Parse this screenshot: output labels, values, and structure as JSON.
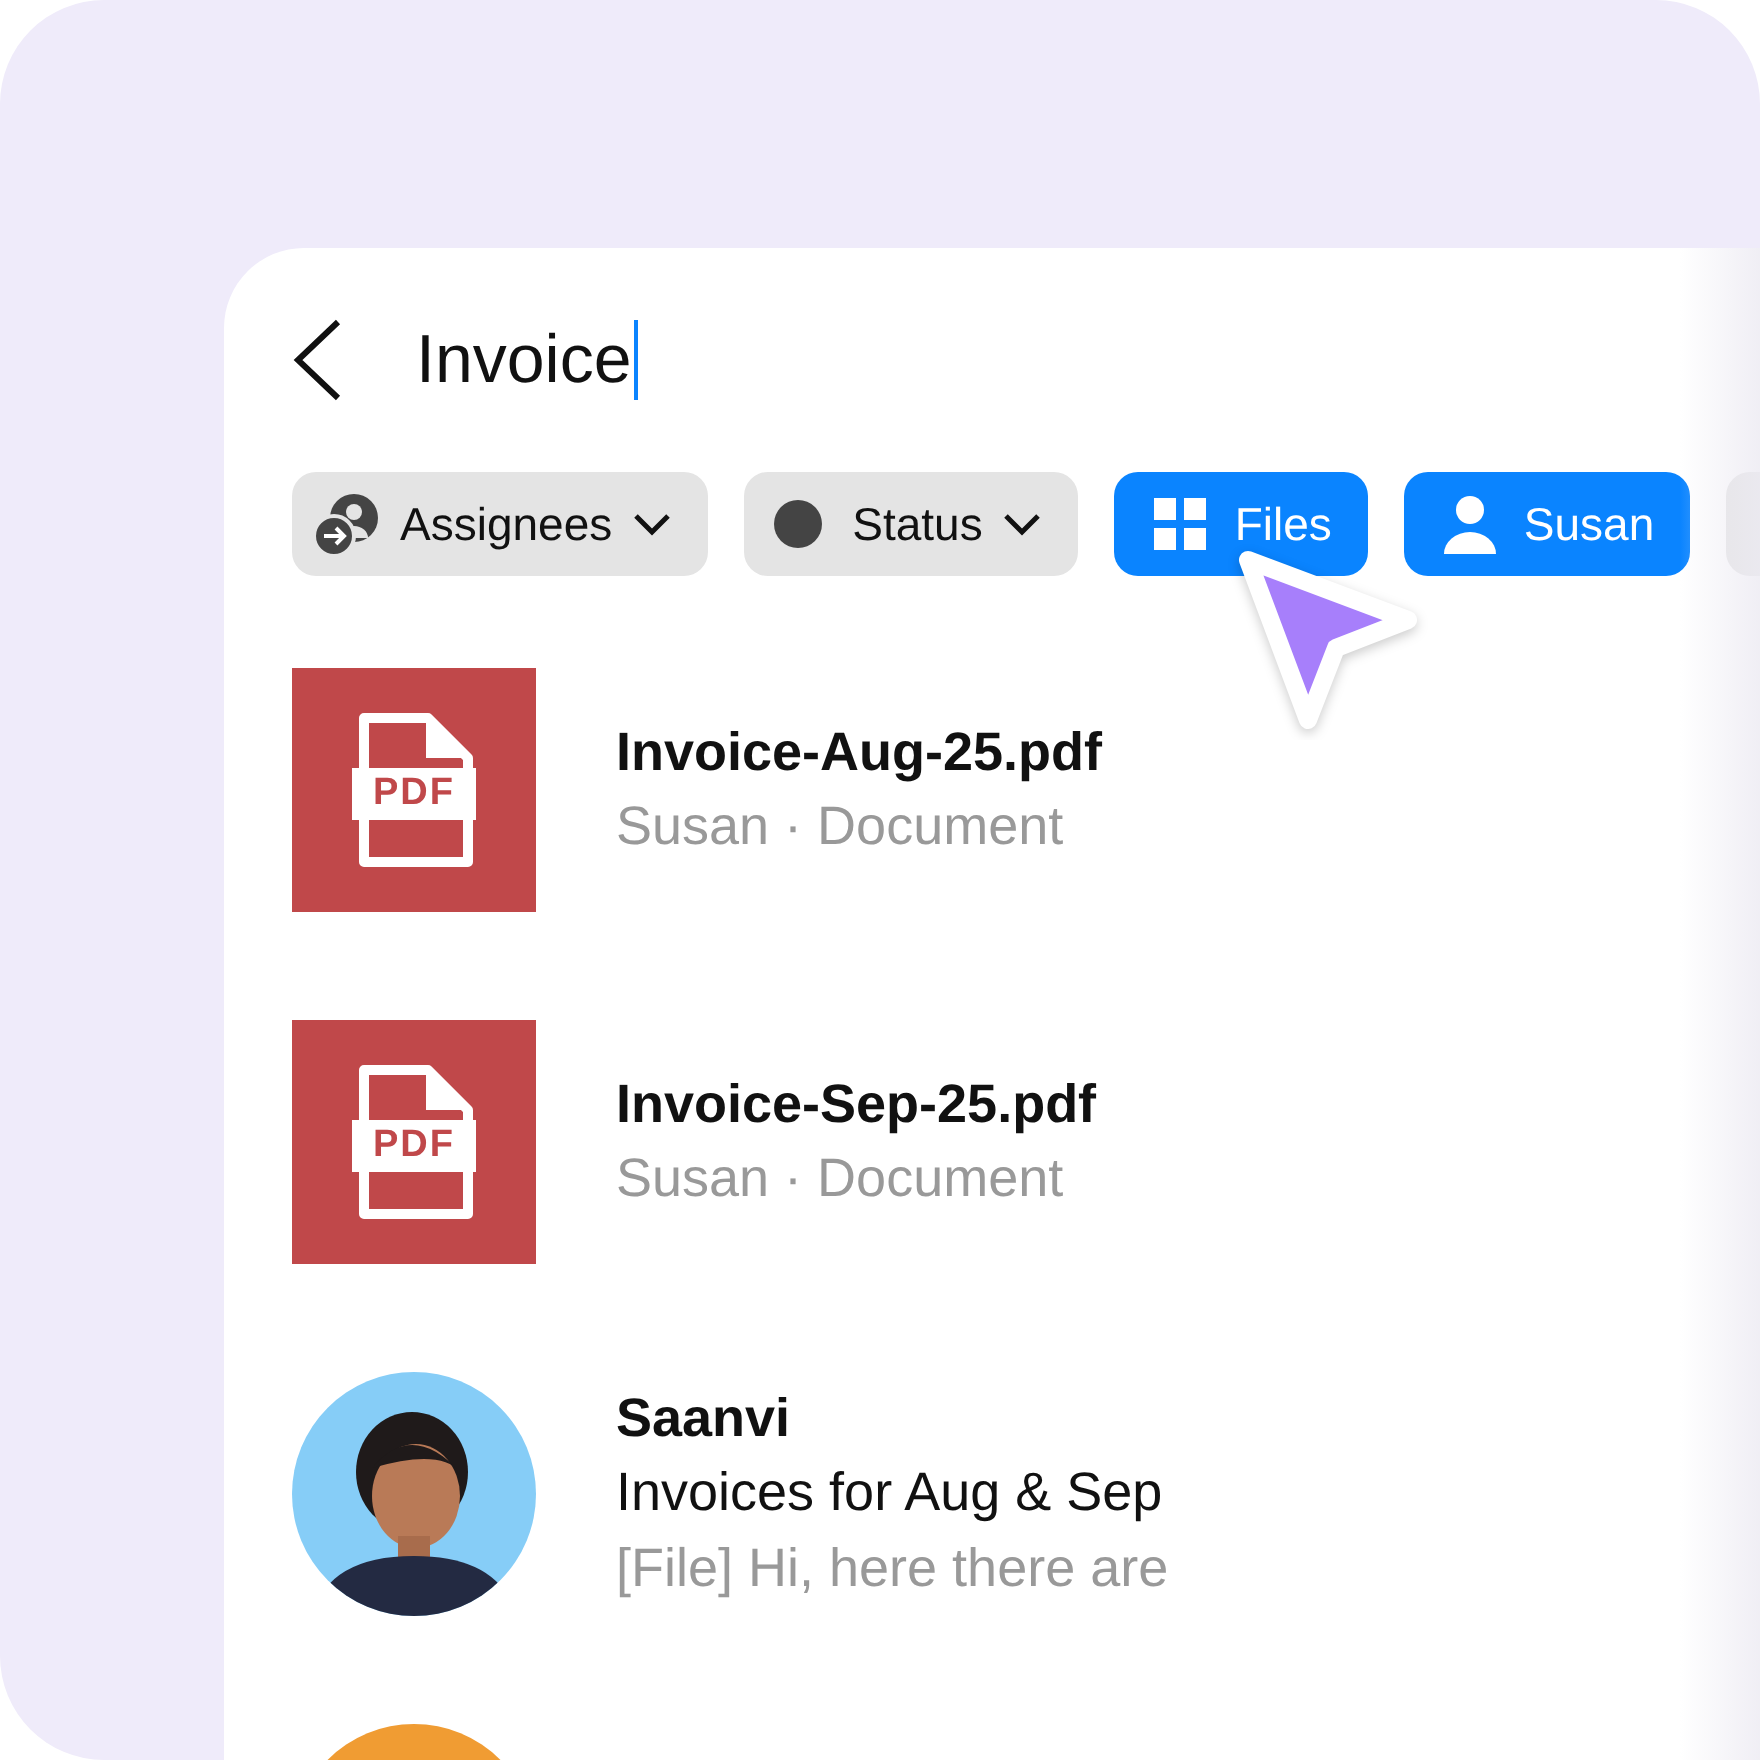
{
  "search": {
    "value": "Invoice"
  },
  "filters": [
    {
      "kind": "assignees",
      "label": "Assignees",
      "dropdown": true,
      "selected": false
    },
    {
      "kind": "status",
      "label": "Status",
      "dropdown": true,
      "selected": false
    },
    {
      "kind": "files",
      "label": "Files",
      "dropdown": false,
      "selected": true
    },
    {
      "kind": "person",
      "label": "Susan",
      "dropdown": false,
      "selected": true
    },
    {
      "kind": "partial",
      "selected": false
    }
  ],
  "results": [
    {
      "kind": "file",
      "badge": "PDF",
      "title": "Invoice-Aug-25.pdf",
      "subtitle": "Susan · Document"
    },
    {
      "kind": "file",
      "badge": "PDF",
      "title": "Invoice-Sep-25.pdf",
      "subtitle": "Susan · Document"
    },
    {
      "kind": "message",
      "title": "Saanvi",
      "subject": "Invoices for Aug & Sep",
      "preview": "[File] Hi, here there are"
    },
    {
      "kind": "contact",
      "color": "#f09c33"
    }
  ]
}
